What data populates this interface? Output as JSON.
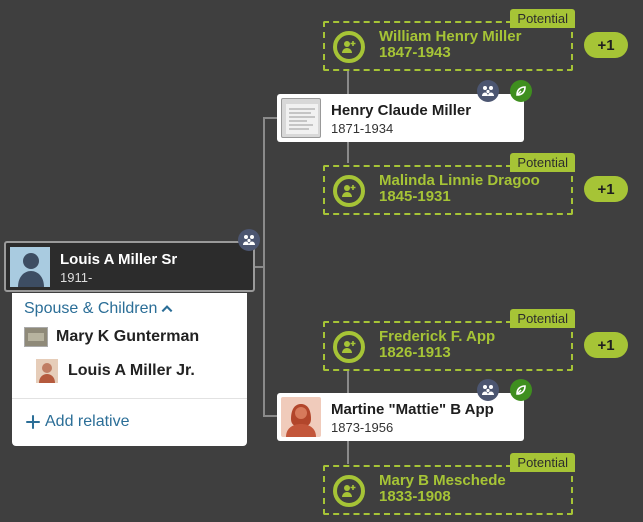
{
  "focus_person": {
    "name": "Louis A Miller Sr",
    "dates": "1911-"
  },
  "family_panel": {
    "header": "Spouse & Children",
    "spouse": "Mary K Gunterman",
    "child": "Louis A Miller Jr.",
    "add_relative": "Add relative"
  },
  "father": {
    "name": "Henry Claude Miller",
    "dates": "1871-1934"
  },
  "mother": {
    "name": "Martine \"Mattie\" B App",
    "dates": "1873-1956"
  },
  "potentials": [
    {
      "badge": "Potential",
      "name": "William Henry Miller",
      "dates": "1847-1943",
      "more": "+1"
    },
    {
      "badge": "Potential",
      "name": "Malinda Linnie Dragoo",
      "dates": "1845-1931",
      "more": "+1"
    },
    {
      "badge": "Potential",
      "name": "Frederick F. App",
      "dates": "1826-1913",
      "more": "+1"
    },
    {
      "badge": "Potential",
      "name": "Mary B Meschede",
      "dates": "1833-1908"
    }
  ],
  "colors": {
    "background": "#3f3f3f",
    "potential_green": "#a6c436",
    "link_blue": "#2b6e97",
    "family_icon_bg": "#4c5671",
    "leaf_icon_bg": "#3f8f1f"
  }
}
